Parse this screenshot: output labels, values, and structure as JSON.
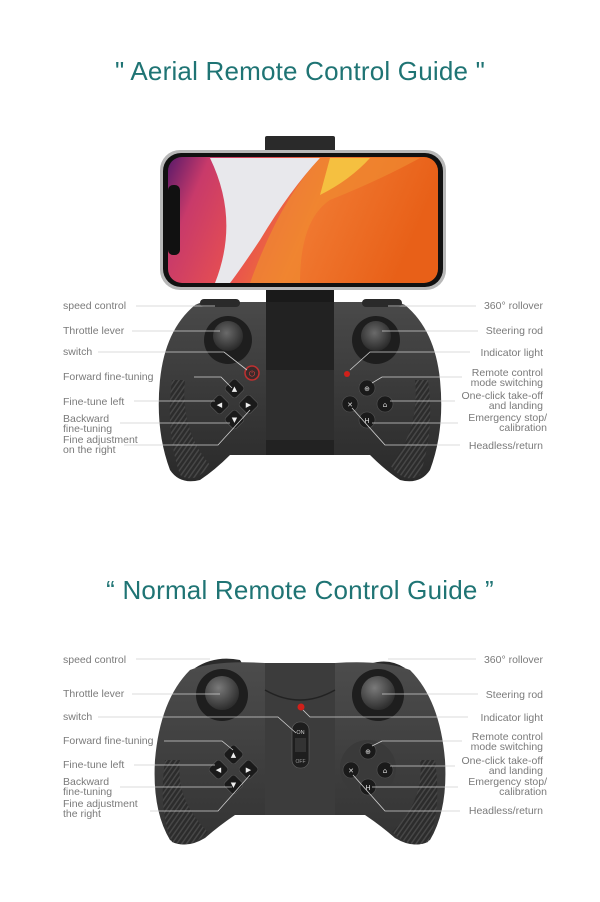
{
  "aerial": {
    "title": "\" Aerial Remote Control Guide \"",
    "left_labels": [
      "speed control",
      "Throttle lever",
      "switch",
      "Forward fine-tuning",
      "Fine-tune left",
      "Backward\nfine-tuning",
      "Fine adjustment\non the right"
    ],
    "right_labels": [
      "360° rollover",
      "Steering rod",
      "Indicator light",
      "Remote control\nmode switching",
      "One-click take-off\nand landing",
      "Emergency stop/\ncalibration",
      "Headless/return"
    ]
  },
  "normal": {
    "title": "“ Normal Remote Control Guide ”",
    "left_labels": [
      "speed control",
      "Throttle lever",
      "switch",
      "Forward fine-tuning",
      "Fine-tune left",
      "Backward\nfine-tuning",
      "Fine adjustment\nthe right"
    ],
    "right_labels": [
      "360° rollover",
      "Steering rod",
      "Indicator light",
      "Remote control\nmode switching",
      "One-click take-off\nand landing",
      "Emergency stop/\ncalibration",
      "Headless/return"
    ],
    "switch_on": "ON",
    "switch_off": "OFF"
  },
  "colors": {
    "title": "#1f7474",
    "label": "#7a7a7a",
    "indicator": "#d0201a"
  }
}
